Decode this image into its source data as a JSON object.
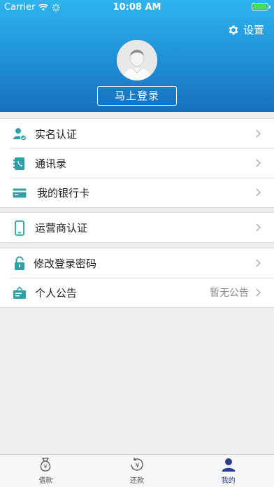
{
  "status_bar": {
    "carrier": "Carrier",
    "time": "10:08 AM",
    "battery_level": 0.95
  },
  "header": {
    "settings_label": "设置",
    "login_button": "马上登录",
    "avatar_icon": "user-avatar-icon"
  },
  "menu": {
    "group1": [
      {
        "label": "实名认证",
        "icon": "id-verify-icon"
      },
      {
        "label": "通讯录",
        "icon": "contacts-icon"
      },
      {
        "label": "我的银行卡",
        "icon": "bank-card-icon"
      }
    ],
    "group2": [
      {
        "label": "运营商认证",
        "icon": "phone-icon"
      }
    ],
    "group3": [
      {
        "label": "修改登录密码",
        "icon": "lock-icon"
      },
      {
        "label": "个人公告",
        "icon": "notice-icon",
        "value": "暂无公告"
      }
    ]
  },
  "tabbar": {
    "tabs": [
      {
        "label": "借款",
        "icon": "money-bag-icon"
      },
      {
        "label": "还款",
        "icon": "repay-icon"
      },
      {
        "label": "我的",
        "icon": "profile-icon",
        "active": true
      }
    ]
  },
  "colors": {
    "header_top": "#2fb4ec",
    "header_bottom": "#176fbc",
    "icon_teal": "#2fa0a8",
    "active_tab": "#2a3f8f"
  }
}
